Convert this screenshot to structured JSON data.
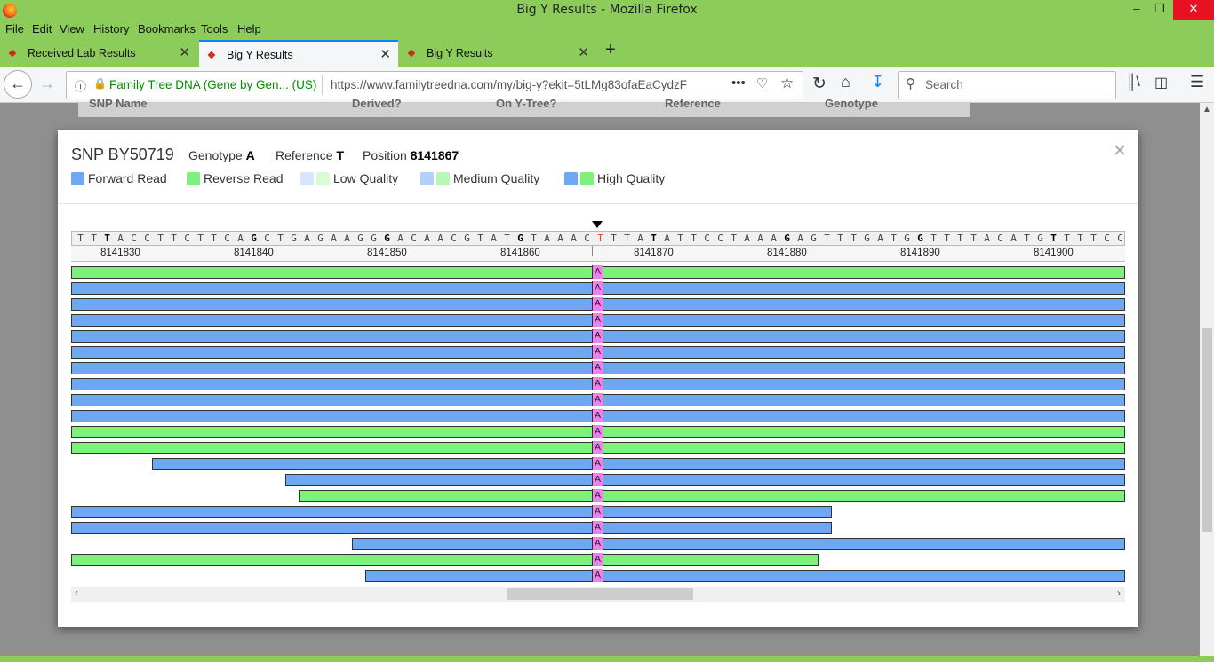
{
  "window": {
    "title": "Big Y Results - Mozilla Firefox"
  },
  "menu": [
    "File",
    "Edit",
    "View",
    "History",
    "Bookmarks",
    "Tools",
    "Help"
  ],
  "tabs": [
    {
      "label": "Received Lab Results"
    },
    {
      "label": "Big Y Results"
    },
    {
      "label": "Big Y Results"
    }
  ],
  "address": {
    "org": "Family Tree DNA (Gene by Gen... (US)",
    "url": "https://www.familytreedna.com/my/big-y?ekit=5tLMg83ofaEaCydzF"
  },
  "search": {
    "placeholder": "Search"
  },
  "page_columns": [
    "SNP Name",
    "Derived?",
    "On Y-Tree?",
    "Reference",
    "Genotype"
  ],
  "modal": {
    "snp": "SNP BY50719",
    "genotype_label": "Genotype",
    "genotype": "A",
    "reference_label": "Reference",
    "reference": "T",
    "position_label": "Position",
    "position": "8141867",
    "legend": {
      "forward": "Forward Read",
      "reverse": "Reverse Read",
      "low": "Low Quality",
      "medium": "Medium Quality",
      "high": "High Quality"
    },
    "colors": {
      "forward": "#6fa8f2",
      "reverse": "#7df27a",
      "variant": "#f080f0",
      "ref_variant": "#ff3333"
    }
  },
  "viewer": {
    "sequence": "TTTACCTTCTTCAGCTGAGAAGGGACAACGTATGTAAACTTTATATTCCTAAAGAGTTTGATGGTTTTACATGTTTTCC",
    "ticks": [
      "8141830",
      "8141840",
      "8141850",
      "8141860",
      "8141870",
      "8141880",
      "8141890",
      "8141900"
    ],
    "variant_base": "A",
    "reads": [
      {
        "dir": "r",
        "start": 0,
        "end": 1186
      },
      {
        "dir": "f",
        "start": 0,
        "end": 1186
      },
      {
        "dir": "f",
        "start": 0,
        "end": 1186
      },
      {
        "dir": "f",
        "start": 0,
        "end": 1186
      },
      {
        "dir": "f",
        "start": 0,
        "end": 1186
      },
      {
        "dir": "f",
        "start": 0,
        "end": 1186
      },
      {
        "dir": "f",
        "start": 0,
        "end": 1186
      },
      {
        "dir": "f",
        "start": 0,
        "end": 1186
      },
      {
        "dir": "f",
        "start": 0,
        "end": 1186
      },
      {
        "dir": "f",
        "start": 0,
        "end": 1186
      },
      {
        "dir": "r",
        "start": 0,
        "end": 1186
      },
      {
        "dir": "r",
        "start": 0,
        "end": 1186
      },
      {
        "dir": "f",
        "start": 91,
        "end": 1186
      },
      {
        "dir": "f",
        "start": 241,
        "end": 1186
      },
      {
        "dir": "r",
        "start": 256,
        "end": 1186
      },
      {
        "dir": "f",
        "start": 0,
        "end": 856
      },
      {
        "dir": "f",
        "start": 0,
        "end": 856
      },
      {
        "dir": "f",
        "start": 316,
        "end": 1186
      },
      {
        "dir": "r",
        "start": 0,
        "end": 841
      },
      {
        "dir": "f",
        "start": 331,
        "end": 1186
      }
    ]
  }
}
